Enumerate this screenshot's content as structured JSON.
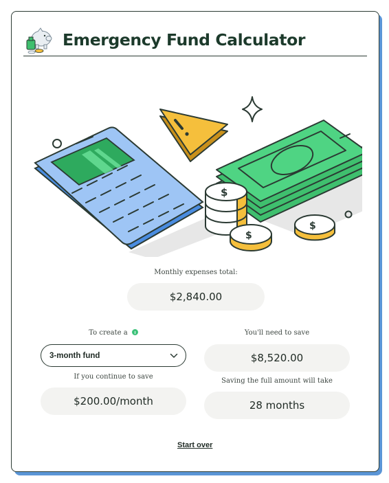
{
  "header": {
    "title": "Emergency Fund Calculator",
    "icon": "piggy-bank-icon"
  },
  "hero": {
    "illustration": "calculator-cash-coins-warning-illustration",
    "warning_icon": "warning-triangle-icon",
    "sparkle_icon": "sparkle-icon"
  },
  "summary": {
    "monthly_expenses_label": "Monthly expenses total:",
    "monthly_expenses_value": "$2,840.00"
  },
  "fund": {
    "create_label": "To create a",
    "info_icon": "info-icon",
    "selected_option": "3-month fund",
    "continue_label": "If you continue to save",
    "monthly_saving_value": "$200.00/month"
  },
  "results": {
    "need_label": "You'll need to save",
    "need_value": "$8,520.00",
    "time_label": "Saving the full amount will take",
    "time_value": "28 months"
  },
  "actions": {
    "start_over": "Start over"
  },
  "colors": {
    "brand_dark_green": "#1c3a2b",
    "accent_blue": "#5b95d6",
    "pill_background": "#f3f3f1",
    "info_green": "#3ec27a",
    "cash_green": "#4fd483",
    "calculator_blue": "#9ec5f5",
    "warning_yellow": "#f5bf3c"
  }
}
